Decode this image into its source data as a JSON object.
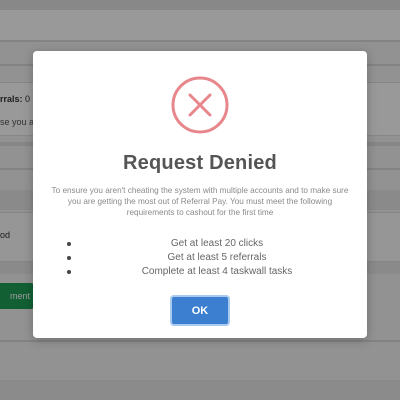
{
  "background": {
    "referrals_label": "rrals:",
    "referrals_value": "0",
    "text_line": "se you a",
    "text_line_2": "od",
    "green_button_label": "ment"
  },
  "modal": {
    "icon": "error-x-circle-icon",
    "icon_color": "#e8878b",
    "title": "Request Denied",
    "description": "To ensure you aren't cheating the system with multiple accounts and to make sure you are getting the most out of Referral Pay. You must meet the following requirements to cashout for the first time",
    "requirements": [
      "Get at least 20 clicks",
      "Get at least 5 referrals",
      "Complete at least 4 taskwall tasks"
    ],
    "ok_label": "OK",
    "ok_color": "#3c7fd1"
  }
}
